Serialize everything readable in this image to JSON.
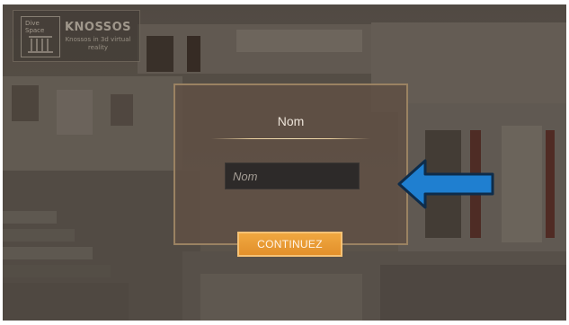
{
  "logo": {
    "badge_text": "Dive\nSpace",
    "title": "KNOSSOS",
    "subtitle": "Knossos in 3d virtual reality"
  },
  "dialog": {
    "title": "Nom",
    "input": {
      "placeholder": "Nom",
      "value": ""
    },
    "continue_label": "CONTINUEZ"
  },
  "colors": {
    "dialog_border": "#9a8262",
    "rule": "#e9cf9e",
    "button": "#e99a33",
    "arrow_fill": "#1f7fd0",
    "arrow_stroke": "#0e2c4a"
  },
  "icons": {
    "hint_arrow": "left-arrow-icon",
    "badge": "columns-icon"
  }
}
